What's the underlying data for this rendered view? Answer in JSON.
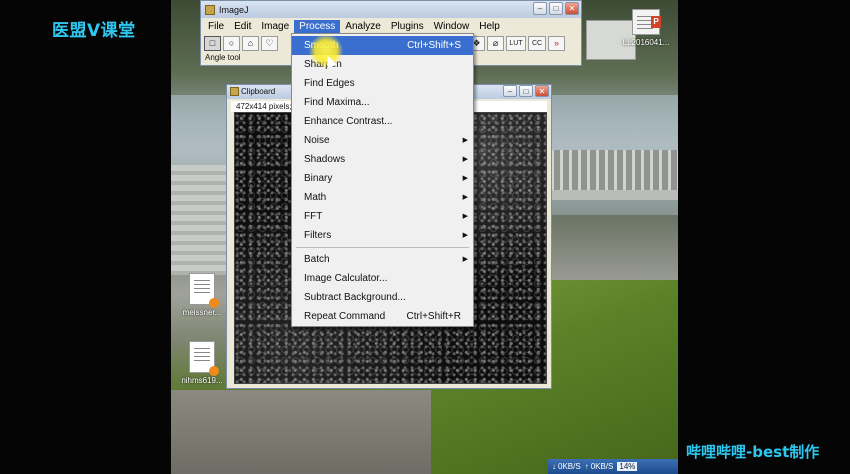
{
  "watermarks": {
    "top": "医盟V课堂",
    "bottom": "哔哩哔哩-best制作"
  },
  "desktop_icons": [
    {
      "name": "LL2016041...",
      "type": "ppt"
    },
    {
      "name": "meissner...",
      "type": "doc"
    },
    {
      "name": "nihms619...",
      "type": "doc"
    }
  ],
  "imagej": {
    "title": "ImageJ",
    "menus": [
      "File",
      "Edit",
      "Image",
      "Process",
      "Analyze",
      "Plugins",
      "Window",
      "Help"
    ],
    "active_menu": "Process",
    "tools": [
      "□",
      "○",
      "⌂",
      "♡",
      "/",
      "∠",
      "✛",
      "✎",
      "A",
      "🔍",
      "✋",
      "✐",
      "✒",
      "❖",
      "⌀",
      "LUT",
      "CC",
      "»"
    ],
    "status": "Angle tool"
  },
  "clipboard": {
    "title": "Clipboard",
    "info": "472x414 pixels; R"
  },
  "process_menu": {
    "items": [
      {
        "label": "Smooth",
        "shortcut": "Ctrl+Shift+S",
        "submenu": false
      },
      {
        "label": "Sharpen",
        "shortcut": "",
        "submenu": false
      },
      {
        "label": "Find Edges",
        "shortcut": "",
        "submenu": false
      },
      {
        "label": "Find Maxima...",
        "shortcut": "",
        "submenu": false
      },
      {
        "label": "Enhance Contrast...",
        "shortcut": "",
        "submenu": false
      },
      {
        "label": "Noise",
        "shortcut": "",
        "submenu": true
      },
      {
        "label": "Shadows",
        "shortcut": "",
        "submenu": true
      },
      {
        "label": "Binary",
        "shortcut": "",
        "submenu": true
      },
      {
        "label": "Math",
        "shortcut": "",
        "submenu": true
      },
      {
        "label": "FFT",
        "shortcut": "",
        "submenu": true
      },
      {
        "label": "Filters",
        "shortcut": "",
        "submenu": true
      },
      {
        "label": "Batch",
        "shortcut": "",
        "submenu": true
      },
      {
        "label": "Image Calculator...",
        "shortcut": "",
        "submenu": false
      },
      {
        "label": "Subtract Background...",
        "shortcut": "",
        "submenu": false
      },
      {
        "label": "Repeat Command",
        "shortcut": "Ctrl+Shift+R",
        "submenu": false
      }
    ],
    "highlighted": "Smooth"
  },
  "taskbar": {
    "down": "0KB/S",
    "up": "0KB/S",
    "percent": "14%"
  },
  "colors": {
    "watermark": "#2ec7f0",
    "menu_highlight": "#3a6fcf"
  }
}
